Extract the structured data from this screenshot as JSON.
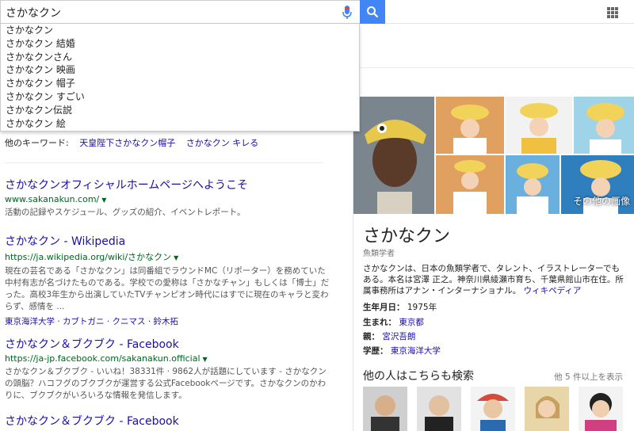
{
  "search": {
    "query": "さかなクン"
  },
  "autocomplete": [
    "さかなクン",
    "さかなクン 結婚",
    "さかなクンさん",
    "さかなクン 映画",
    "さかなクン 帽子",
    "さかなクン すごい",
    "さかなクン伝説",
    "さかなクン 絵"
  ],
  "other_keywords": {
    "label": "他のキーワード:",
    "items": [
      "天皇陛下さかなクン帽子",
      "さかなクン キレる"
    ]
  },
  "results": [
    {
      "title": "さかなクンオフィシャルホームページへようこそ",
      "url": "www.sakanakun.com/",
      "snippet": "活動の記録やスケジュール、グッズの紹介、イベントレポート。"
    },
    {
      "title": "さかなクン - Wikipedia",
      "url": "https://ja.wikipedia.org/wiki/さかなクン",
      "snippet": "現在の芸名である「さかなクン」は同番組でラウンドMC（リポーター）を務めていた中村有志が名づけたものである。学校での愛称は「さかなチャン」もしくは「博士」だった。高校3年生から出演していたTVチャンピオン時代にはすでに現在のキャラと変わらず、感情を ...",
      "sitelinks": [
        "東京海洋大学",
        "カブトガニ",
        "クニマス",
        "鈴木拓"
      ]
    },
    {
      "title": "さかなクン＆ブクブク - Facebook",
      "url": "https://ja-jp.facebook.com/sakanakun.official",
      "snippet": "さかなクン＆ブクブク - いいね！38331件 · 9862人が話題にしています - さかなクンの頭脳？ハコフグのブクブクが運営する公式Facebookページです。さかなクンのかわりに、ブクブクがいろいろな情報を発信します。"
    },
    {
      "title": "さかなクン＆ブクブク - Facebook"
    }
  ],
  "knowledge_panel": {
    "more_images": "その他の画像",
    "title": "さかなクン",
    "subtitle": "魚類学者",
    "description": "さかなクンは、日本の魚類学者で、タレント、イラストレーターでもある。本名は宮澤 正之。神奈川県綾瀬市育ち、千葉県館山市在住。所属事務所はアナン・インターナショナル。",
    "wiki_link": "ウィキペディア",
    "facts": [
      {
        "label": "生年月日：",
        "value": "1975年",
        "link": false
      },
      {
        "label": "生まれ：",
        "value": "東京都",
        "link": true
      },
      {
        "label": "親：",
        "value": "宮沢吾朗",
        "link": true
      },
      {
        "label": "学歴：",
        "value": "東京海洋大学",
        "link": true
      }
    ],
    "others_heading": "他の人はこちらも検索",
    "others_more": "他 5 件以上を表示"
  },
  "colors": {
    "link": "#1a0dab",
    "url_green": "#006621",
    "search_blue": "#4285f4"
  }
}
